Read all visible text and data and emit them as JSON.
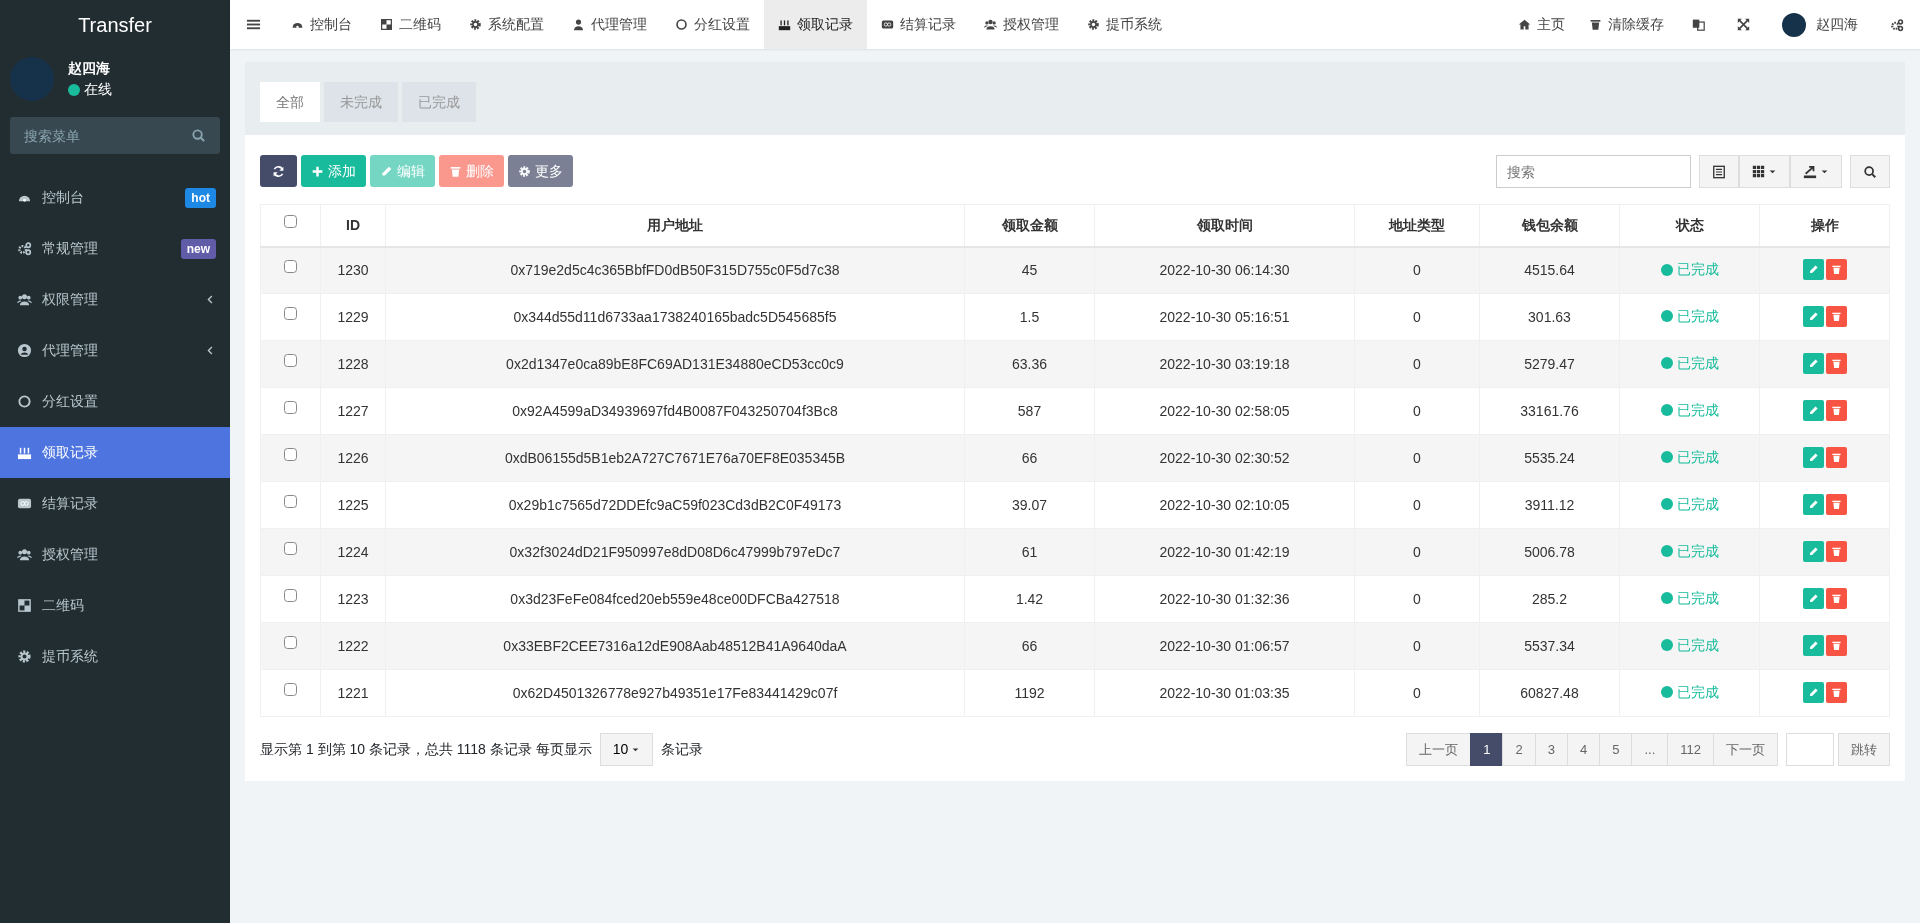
{
  "sidebar": {
    "brand": "Transfer",
    "user": {
      "name": "赵四海",
      "status": "在线"
    },
    "search": {
      "placeholder": "搜索菜单"
    },
    "items": [
      {
        "label": "控制台",
        "badge": "hot",
        "color": "#1e88e5",
        "has_submenu": false,
        "selected": false
      },
      {
        "label": "常规管理",
        "badge": "new",
        "color": "#605ca8",
        "has_submenu": false,
        "selected": false
      },
      {
        "label": "权限管理",
        "has_submenu": true,
        "selected": false
      },
      {
        "label": "代理管理",
        "has_submenu": true,
        "selected": false
      },
      {
        "label": "分红设置",
        "has_submenu": false,
        "selected": false
      },
      {
        "label": "领取记录",
        "has_submenu": false,
        "selected": true
      },
      {
        "label": "结算记录",
        "has_submenu": false,
        "selected": false
      },
      {
        "label": "授权管理",
        "has_submenu": false,
        "selected": false
      },
      {
        "label": "二维码",
        "has_submenu": false,
        "selected": false
      },
      {
        "label": "提币系统",
        "has_submenu": false,
        "selected": false
      }
    ]
  },
  "top_nav": {
    "items": [
      {
        "label": "控制台",
        "selected": false
      },
      {
        "label": "二维码",
        "selected": false
      },
      {
        "label": "系统配置",
        "selected": false
      },
      {
        "label": "代理管理",
        "selected": false
      },
      {
        "label": "分红设置",
        "selected": false
      },
      {
        "label": "领取记录",
        "selected": true
      },
      {
        "label": "结算记录",
        "selected": false
      },
      {
        "label": "授权管理",
        "selected": false
      },
      {
        "label": "提币系统",
        "selected": false
      }
    ],
    "right": [
      {
        "label": "主页"
      },
      {
        "label": "清除缓存"
      }
    ],
    "user": {
      "name": "赵四海"
    }
  },
  "tabs": [
    {
      "label": "全部",
      "selected": true
    },
    {
      "label": "未完成",
      "selected": false
    },
    {
      "label": "已完成",
      "selected": false
    }
  ],
  "toolbar": {
    "buttons": [
      {
        "kind": "refresh",
        "disabled": false
      },
      {
        "kind": "add",
        "label": "添加",
        "disabled": false
      },
      {
        "kind": "edit",
        "label": "编辑",
        "disabled": true
      },
      {
        "kind": "delete",
        "label": "删除",
        "disabled": true
      },
      {
        "kind": "more",
        "label": "更多",
        "disabled": false
      }
    ],
    "search": {
      "placeholder": "搜索"
    }
  },
  "table": {
    "all_checked": false,
    "columns": [
      "ID",
      "用户地址",
      "领取金额",
      "领取时间",
      "地址类型",
      "钱包余额",
      "状态",
      "操作"
    ],
    "rows": [
      {
        "id": "1230",
        "address": "0x719e2d5c4c365BbfFD0dB50F315D755c0F5d7c38",
        "amount": "45",
        "time": "2022-10-30 06:14:30",
        "type": "0",
        "balance": "4515.64",
        "status": "已完成",
        "checked": false
      },
      {
        "id": "1229",
        "address": "0x344d55d11d6733aa1738240165badc5D545685f5",
        "amount": "1.5",
        "time": "2022-10-30 05:16:51",
        "type": "0",
        "balance": "301.63",
        "status": "已完成",
        "checked": false
      },
      {
        "id": "1228",
        "address": "0x2d1347e0ca89bE8FC69AD131E34880eCD53cc0c9",
        "amount": "63.36",
        "time": "2022-10-30 03:19:18",
        "type": "0",
        "balance": "5279.47",
        "status": "已完成",
        "checked": false
      },
      {
        "id": "1227",
        "address": "0x92A4599aD34939697fd4B0087F043250704f3Bc8",
        "amount": "587",
        "time": "2022-10-30 02:58:05",
        "type": "0",
        "balance": "33161.76",
        "status": "已完成",
        "checked": false
      },
      {
        "id": "1226",
        "address": "0xdB06155d5B1eb2A727C7671E76a70EF8E035345B",
        "amount": "66",
        "time": "2022-10-30 02:30:52",
        "type": "0",
        "balance": "5535.24",
        "status": "已完成",
        "checked": false
      },
      {
        "id": "1225",
        "address": "0x29b1c7565d72DDEfc9aC59f023Cd3dB2C0F49173",
        "amount": "39.07",
        "time": "2022-10-30 02:10:05",
        "type": "0",
        "balance": "3911.12",
        "status": "已完成",
        "checked": false
      },
      {
        "id": "1224",
        "address": "0x32f3024dD21F950997e8dD08D6c47999b797eDc7",
        "amount": "61",
        "time": "2022-10-30 01:42:19",
        "type": "0",
        "balance": "5006.78",
        "status": "已完成",
        "checked": false
      },
      {
        "id": "1223",
        "address": "0x3d23FeFe084fced20eb559e48ce00DFCBa427518",
        "amount": "1.42",
        "time": "2022-10-30 01:32:36",
        "type": "0",
        "balance": "285.2",
        "status": "已完成",
        "checked": false
      },
      {
        "id": "1222",
        "address": "0x33EBF2CEE7316a12dE908Aab48512B41A9640daA",
        "amount": "66",
        "time": "2022-10-30 01:06:57",
        "type": "0",
        "balance": "5537.34",
        "status": "已完成",
        "checked": false
      },
      {
        "id": "1221",
        "address": "0x62D4501326778e927b49351e17Fe83441429c07f",
        "amount": "1192",
        "time": "2022-10-30 01:03:35",
        "type": "0",
        "balance": "60827.48",
        "status": "已完成",
        "checked": false
      }
    ]
  },
  "footer": {
    "summary": "显示第 1 到第 10 条记录，总共 1118 条记录 每页显示",
    "page_size": "10",
    "page_size_suffix": "条记录",
    "pages": [
      {
        "label": "上一页",
        "selected": false
      },
      {
        "label": "1",
        "selected": true
      },
      {
        "label": "2",
        "selected": false
      },
      {
        "label": "3",
        "selected": false
      },
      {
        "label": "4",
        "selected": false
      },
      {
        "label": "5",
        "selected": false
      },
      {
        "label": "...",
        "selected": false
      },
      {
        "label": "112",
        "selected": false
      },
      {
        "label": "下一页",
        "selected": false
      }
    ],
    "jump": "跳转"
  }
}
